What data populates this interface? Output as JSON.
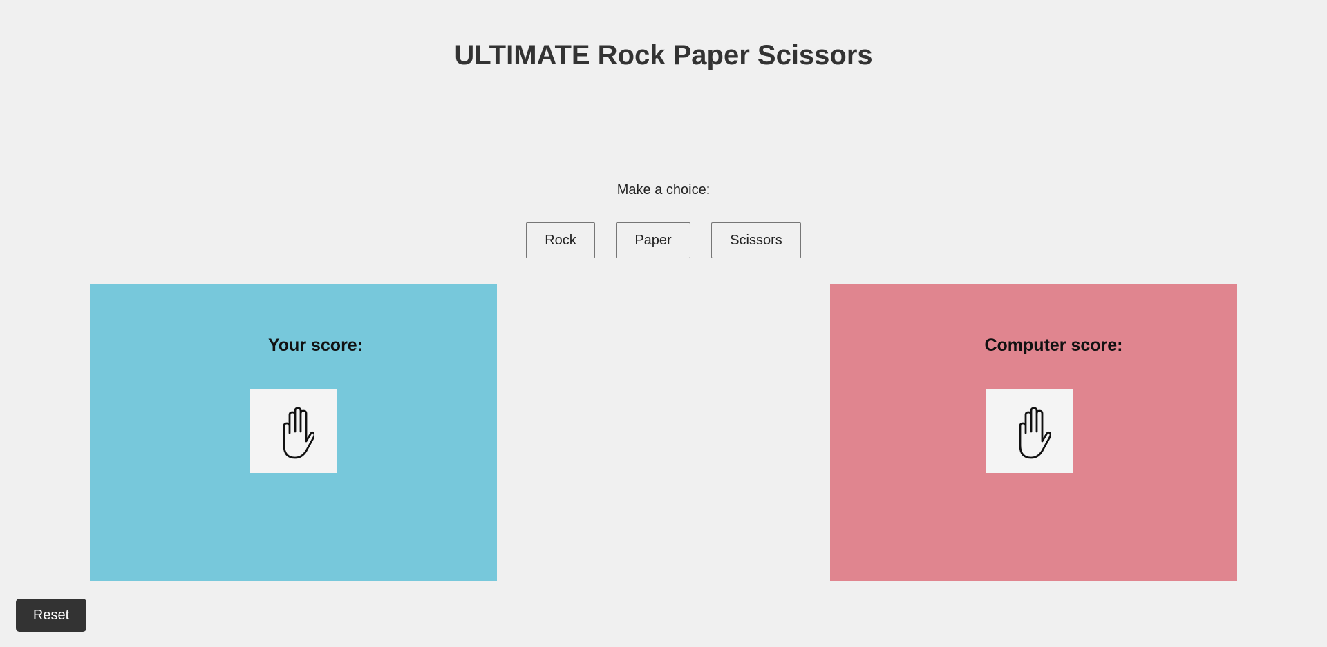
{
  "title": "ULTIMATE Rock Paper Scissors",
  "prompt": "Make a choice:",
  "choices": {
    "rock": "Rock",
    "paper": "Paper",
    "scissors": "Scissors"
  },
  "player": {
    "label": "Your score:",
    "hand_icon": "hand-palm-icon",
    "panel_color": "#77c8db"
  },
  "computer": {
    "label": "Computer score:",
    "hand_icon": "hand-palm-icon",
    "panel_color": "#e0858f"
  },
  "reset_label": "Reset",
  "colors": {
    "background": "#f0f0f0",
    "reset_button": "#333333",
    "hand_box": "#f4f4f4"
  }
}
